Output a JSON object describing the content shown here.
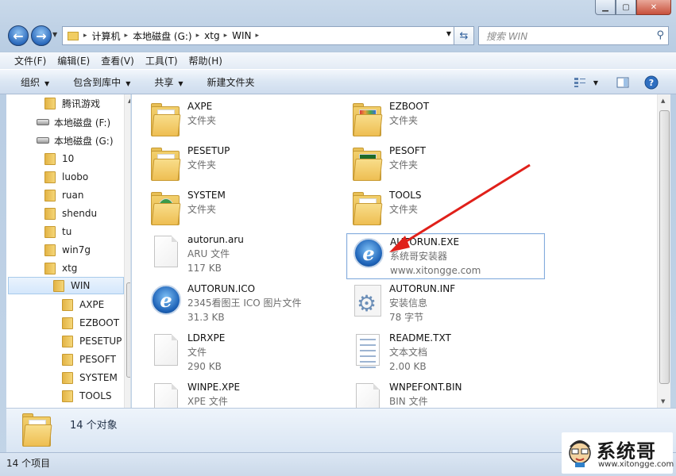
{
  "nav": {
    "back": "back",
    "forward": "forward"
  },
  "address": {
    "crumbs": [
      "计算机",
      "本地磁盘 (G:)",
      "xtg",
      "WIN"
    ]
  },
  "search": {
    "placeholder": "搜索 WIN"
  },
  "menu": [
    "文件(F)",
    "编辑(E)",
    "查看(V)",
    "工具(T)",
    "帮助(H)"
  ],
  "toolbar": {
    "organize": "组织",
    "include": "包含到库中",
    "share": "共享",
    "newfolder": "新建文件夹"
  },
  "tree": [
    {
      "label": "腾讯游戏",
      "kind": "folder"
    },
    {
      "label": "本地磁盘 (F:)",
      "kind": "drive"
    },
    {
      "label": "本地磁盘 (G:)",
      "kind": "drive"
    },
    {
      "label": "10",
      "kind": "folder"
    },
    {
      "label": "luobo",
      "kind": "folder"
    },
    {
      "label": "ruan",
      "kind": "folder"
    },
    {
      "label": "shendu",
      "kind": "folder"
    },
    {
      "label": "tu",
      "kind": "folder"
    },
    {
      "label": "win7g",
      "kind": "folder"
    },
    {
      "label": "xtg",
      "kind": "folder"
    },
    {
      "label": "WIN",
      "kind": "folder",
      "selected": true
    },
    {
      "label": "AXPE",
      "kind": "folder"
    },
    {
      "label": "EZBOOT",
      "kind": "folder"
    },
    {
      "label": "PESETUP",
      "kind": "folder"
    },
    {
      "label": "PESOFT",
      "kind": "folder"
    },
    {
      "label": "SYSTEM",
      "kind": "folder"
    },
    {
      "label": "TOOLS",
      "kind": "folder"
    }
  ],
  "files": [
    {
      "name": "AXPE",
      "l2": "文件夹",
      "l3": "",
      "icon": "folder"
    },
    {
      "name": "EZBOOT",
      "l2": "文件夹",
      "l3": "",
      "icon": "folder"
    },
    {
      "name": "PESETUP",
      "l2": "文件夹",
      "l3": "",
      "icon": "folder"
    },
    {
      "name": "PESOFT",
      "l2": "文件夹",
      "l3": "",
      "icon": "folder"
    },
    {
      "name": "SYSTEM",
      "l2": "文件夹",
      "l3": "",
      "icon": "folder"
    },
    {
      "name": "TOOLS",
      "l2": "文件夹",
      "l3": "",
      "icon": "folder"
    },
    {
      "name": "autorun.aru",
      "l2": "ARU 文件",
      "l3": "117 KB",
      "icon": "doc"
    },
    {
      "name": "AUTORUN.EXE",
      "l2": "系统哥安装器",
      "l3": "www.xitongge.com",
      "icon": "ie",
      "selected": true
    },
    {
      "name": "AUTORUN.ICO",
      "l2": "2345看图王 ICO 图片文件",
      "l3": "31.3 KB",
      "icon": "ie"
    },
    {
      "name": "AUTORUN.INF",
      "l2": "安装信息",
      "l3": "78 字节",
      "icon": "gear"
    },
    {
      "name": "LDRXPE",
      "l2": "文件",
      "l3": "290 KB",
      "icon": "doc"
    },
    {
      "name": "README.TXT",
      "l2": "文本文档",
      "l3": "2.00 KB",
      "icon": "txt"
    },
    {
      "name": "WINPE.XPE",
      "l2": "XPE 文件",
      "l3": "",
      "icon": "doc"
    },
    {
      "name": "WNPEFONT.BIN",
      "l2": "BIN 文件",
      "l3": "",
      "icon": "doc"
    }
  ],
  "details": {
    "count": "14 个对象"
  },
  "status": {
    "text": "14 个项目"
  },
  "watermark": {
    "brand": "系统哥",
    "url": "www.xitongge.com"
  },
  "colors": {
    "arrow": "#e0201a",
    "selection_border": "#84acdd"
  }
}
